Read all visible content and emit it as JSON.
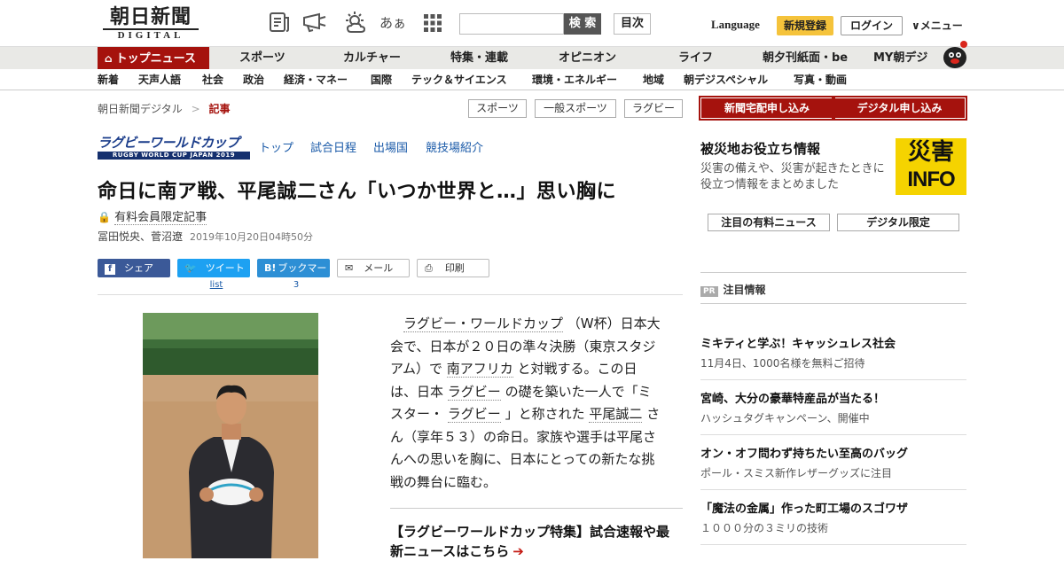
{
  "header": {
    "logo_jp": "朝日新聞",
    "logo_en": "DIGITAL",
    "icons": [
      "newspaper-icon",
      "megaphone-icon",
      "weather-icon",
      "font-size-icon",
      "grid-icon"
    ],
    "font_icon_text": "あぁ",
    "search_placeholder": "",
    "search_button": "検 索",
    "mokuji": "目次",
    "language": "Language",
    "register": "新規登録",
    "login": "ログイン",
    "menu": "∨メニュー"
  },
  "nav_main": {
    "top": "トップニュース",
    "items": [
      "スポーツ",
      "カルチャー",
      "特集・連載",
      "オピニオン",
      "ライフ",
      "朝夕刊紙面・be",
      "MY朝デジ"
    ]
  },
  "nav_sub": [
    "新着",
    "天声人語",
    "社会",
    "政治",
    "経済・マネー",
    "国際",
    "テック＆サイエンス",
    "環境・エネルギー",
    "地域",
    "朝デジスペシャル",
    "写真・動画"
  ],
  "breadcrumb": {
    "root": "朝日新聞デジタル",
    "sep": ">",
    "current": "記事"
  },
  "tags": [
    "スポーツ",
    "一般スポーツ",
    "ラグビー"
  ],
  "rwc": {
    "logo_top": "ラグビーワールドカップ",
    "logo_bottom": "RUGBY WORLD CUP JAPAN 2019",
    "links": [
      "トップ",
      "試合日程",
      "出場国",
      "競技場紹介"
    ]
  },
  "article": {
    "title": "命日に南ア戦、平尾誠二さん「いつか世界と…」思い胸に",
    "paid": "有料会員限定記事",
    "authors": "冨田悦央、菅沼遼",
    "date": "2019年10月20日04時50分",
    "share": {
      "facebook": "シェア",
      "twitter": "ツイート",
      "twitter_count": "list",
      "hatena": "ブックマーク",
      "hatena_count": "3",
      "mail": "メール",
      "print": "印刷"
    },
    "body": {
      "p1": "ラグビー・ワールドカップ",
      "p2": "（W杯）日本大会で、日本が２０日の準々決勝（東京スタジアム）で",
      "p3": "南アフリカ",
      "p4": "と対戦する。この日は、日本",
      "p5": "ラグビー",
      "p6": "の礎を築いた一人で「ミスター・",
      "p7": "ラグビー",
      "p8": "」と称された",
      "p9": "平尾誠二",
      "p10": "さん（享年５３）の命日。家族や選手は平尾さんへの思いを胸に、日本にとっての新たな挑戦の舞台に臨む。"
    },
    "feature_link": "【ラグビーワールドカップ特集】試合速報や最新ニュースはこちら"
  },
  "sidebar": {
    "subscribe_paper": "新聞宅配申し込み",
    "subscribe_digital": "デジタル申し込み",
    "disaster": {
      "heading": "被災地お役立ち情報",
      "text": "災害の備えや、災害が起きたときに役立つ情報をまとめました",
      "badge_top": "災害",
      "badge_bottom": "INFO"
    },
    "btn_paid_news": "注目の有料ニュース",
    "btn_digital_only": "デジタル限定",
    "pr_badge": "PR",
    "pr_title": "注目情報",
    "pr_items": [
      {
        "headline": "ミキティと学ぶ！キャッシュレス社会",
        "sub": "11月4日、1000名様を無料ご招待"
      },
      {
        "headline": "宮崎、大分の豪華特産品が当たる！",
        "sub": "ハッシュタグキャンペーン、開催中"
      },
      {
        "headline": "オン・オフ問わず持ちたい至高のバッグ",
        "sub": "ポール・スミス新作レザーグッズに注目"
      },
      {
        "headline": "「魔法の金属」作った町工場のスゴワザ",
        "sub": "１０００分の３ミリの技術"
      }
    ]
  },
  "colors": {
    "brand_red": "#a5120d",
    "accent_yellow": "#f5c33b",
    "facebook": "#3b5998",
    "twitter": "#1da1f2",
    "hatena": "#2d8fd5"
  }
}
